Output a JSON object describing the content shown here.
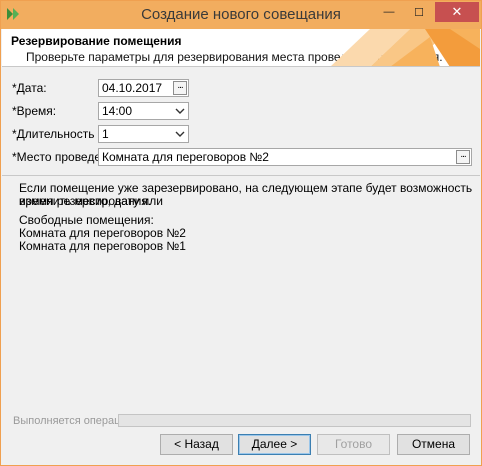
{
  "window": {
    "title": "Создание нового совещания",
    "controls": {
      "minimize": "—",
      "maximize": "☐",
      "close": "✕"
    }
  },
  "header": {
    "title": "Резервирование помещения",
    "subtitle": "Проверьте параметры для резервирования места проведения совещания."
  },
  "form": {
    "date": {
      "label": "*Дата:",
      "value": "04.10.2017",
      "button": "..."
    },
    "time": {
      "label": "*Время:",
      "value": "14:00"
    },
    "duration": {
      "label": "*Длительность (ч):",
      "value": "1"
    },
    "place": {
      "label": "*Место проведения:",
      "value": "Комната для переговоров №2",
      "button": "..."
    }
  },
  "info": {
    "notice_line1": "Если помещение уже зарезервировано, на следующем этапе будет возможность изменить место, дату или",
    "notice_line2": "время резервирования.",
    "free_rooms_label": "Свободные помещения:",
    "free_rooms": [
      "Комната для переговоров №2",
      "Комната для переговоров №1"
    ]
  },
  "status": {
    "label": "Выполняется операция",
    "progress": 0
  },
  "buttons": {
    "back": "< Назад",
    "next": "Далее >",
    "done": "Готово",
    "cancel": "Отмена"
  },
  "colors": {
    "accent": "#f2ad5f",
    "close": "#c75050",
    "banner_art": [
      "#f7b25c",
      "#f9c786",
      "#f39c3c"
    ]
  }
}
